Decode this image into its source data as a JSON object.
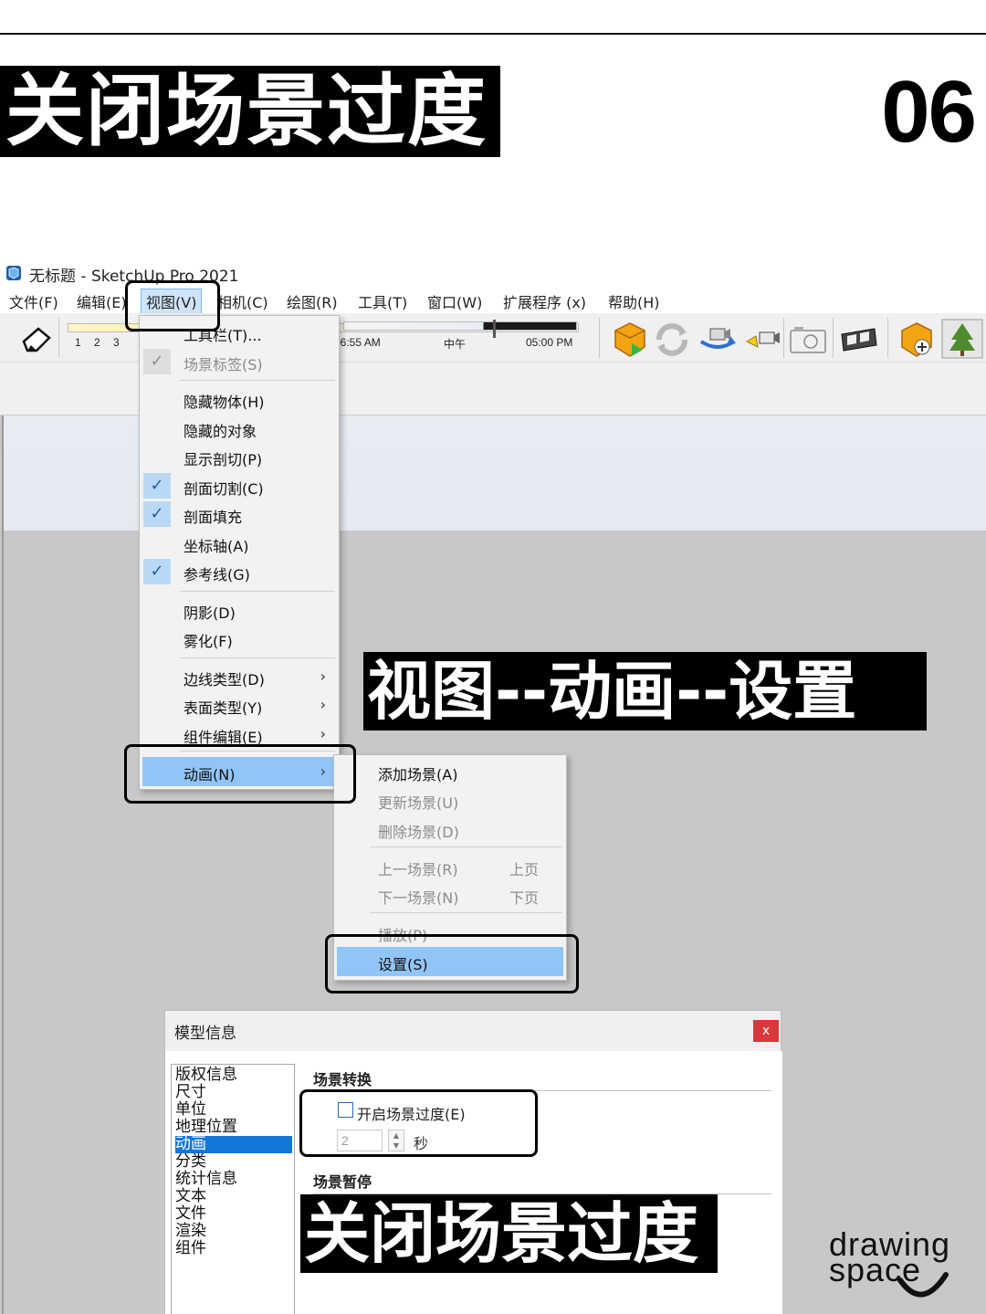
{
  "poster": {
    "title": "关闭场景过度",
    "page_number": "06"
  },
  "app": {
    "window_title": "无标题 - SketchUp Pro 2021",
    "menus": [
      "文件(F)",
      "编辑(E)",
      "视图(V)",
      "相机(C)",
      "绘图(R)",
      "工具(T)",
      "窗口(W)",
      "扩展程序 (x)",
      "帮助(H)"
    ],
    "active_menu": "视图(V)"
  },
  "toolbar": {
    "month_ticks": [
      "1",
      "2",
      "3"
    ],
    "time_start": "06:55 AM",
    "time_mid": "中午",
    "time_end": "05:00 PM",
    "icons": [
      "add-scene-icon",
      "update-scene-icon",
      "swap-camera-icon",
      "camera-icon",
      "photo-camera-icon",
      "vr-headset-icon",
      "scene-add-icon",
      "tree-icon"
    ]
  },
  "view_menu": {
    "items": [
      {
        "label": "工具栏(T)...",
        "checked": false,
        "dim": false
      },
      {
        "label": "场景标签(S)",
        "checked": true,
        "dim": true
      },
      {
        "label": "隐藏物体(H)",
        "checked": false,
        "dim": false
      },
      {
        "label": "隐藏的对象",
        "checked": false,
        "dim": false
      },
      {
        "label": "显示剖切(P)",
        "checked": false,
        "dim": false
      },
      {
        "label": "剖面切割(C)",
        "checked": true,
        "dim": false
      },
      {
        "label": "剖面填充",
        "checked": true,
        "dim": false
      },
      {
        "label": "坐标轴(A)",
        "checked": false,
        "dim": false
      },
      {
        "label": "参考线(G)",
        "checked": true,
        "dim": false
      },
      {
        "label": "阴影(D)",
        "checked": false,
        "dim": false
      },
      {
        "label": "雾化(F)",
        "checked": false,
        "dim": false
      },
      {
        "label": "边线类型(D)",
        "submenu": true
      },
      {
        "label": "表面类型(Y)",
        "submenu": true
      },
      {
        "label": "组件编辑(E)",
        "submenu": true
      },
      {
        "label": "动画(N)",
        "submenu": true,
        "highlighted": true
      }
    ]
  },
  "animation_menu": {
    "items": [
      {
        "label": "添加场景(A)",
        "enabled": true
      },
      {
        "label": "更新场景(U)",
        "enabled": false
      },
      {
        "label": "删除场景(D)",
        "enabled": false
      },
      {
        "label": "上一场景(R)",
        "shortcut": "上页",
        "enabled": false
      },
      {
        "label": "下一场景(N)",
        "shortcut": "下页",
        "enabled": false
      },
      {
        "label": "播放(P)",
        "enabled": false
      },
      {
        "label": "设置(S)",
        "enabled": true,
        "highlighted": true
      }
    ]
  },
  "annotations": {
    "path_label": "视图--动画--设置",
    "bottom_label": "关闭场景过度"
  },
  "dialog": {
    "title": "模型信息",
    "close": "x",
    "categories": [
      "版权信息",
      "尺寸",
      "单位",
      "地理位置",
      "动画",
      "分类",
      "统计信息",
      "文本",
      "文件",
      "渲染",
      "组件"
    ],
    "selected_category": "动画",
    "section_transition": "场景转换",
    "enable_transition_label": "开启场景过度(E)",
    "enable_transition_checked": false,
    "transition_seconds": "2",
    "seconds_unit": "秒",
    "section_delay": "场景暂停"
  },
  "brand": {
    "line1": "drawing",
    "line2": "space"
  },
  "colors": {
    "menu_highlight": "#92c5f7",
    "list_selection": "#1177d8",
    "close_button": "#d8393a",
    "label_bg": "#000000",
    "label_text": "#ffffff"
  }
}
